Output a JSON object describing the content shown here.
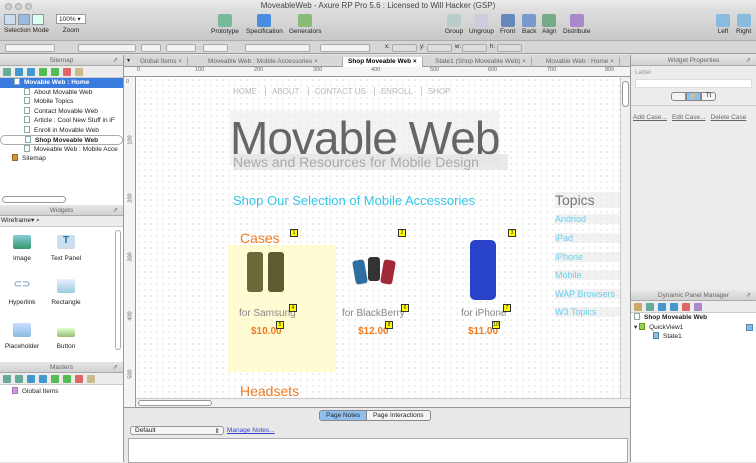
{
  "window": {
    "title": "MoveableWeb - Axure RP Pro 5.6 : Licensed to Will Hacker (GSP)"
  },
  "toolbar": {
    "selection_mode": "Selection Mode",
    "zoom_value": "100%",
    "zoom_label": "Zoom",
    "prototype": "Prototype",
    "specification": "Specification",
    "generators": "Generators",
    "group": "Group",
    "ungroup": "Ungroup",
    "front": "Front",
    "back": "Back",
    "align": "Align",
    "distribute": "Distribute",
    "left": "Left",
    "right": "Right"
  },
  "fmtbar": {
    "x": "x:",
    "y": "y:",
    "w": "w:",
    "h": "h:"
  },
  "sitemap": {
    "title": "Sitemap",
    "root": "Movable Web : Home",
    "items": [
      "About Movable Web",
      "Mobile Topics",
      "Contact Movable Web",
      "Article : Cool New Stuff in iF",
      "Enroll in Movable Web",
      "Shop Moveable Web",
      "Moveable Web : Mobile Acce"
    ],
    "sitemap_node": "Sitemap"
  },
  "widgets": {
    "title": "Widgets",
    "library": "Wireframe",
    "items": [
      "Image",
      "Text Panel",
      "Hyperlink",
      "Rectangle",
      "Placeholder",
      "Button"
    ]
  },
  "masters": {
    "title": "Masters",
    "items": [
      "Global Items"
    ]
  },
  "tabs": [
    "Global Items",
    "Moveable Web : Mobile Accessories",
    "Shop Moveable Web",
    "State1 (Shop Moveable Web)",
    "Movable Web : Home"
  ],
  "ruler": [
    "0",
    "100",
    "200",
    "300",
    "400",
    "500",
    "600",
    "700",
    "800"
  ],
  "vruler": [
    "0",
    "100",
    "200",
    "300",
    "400",
    "500"
  ],
  "page": {
    "nav": [
      "HOME",
      "ABOUT",
      "CONTACT US",
      "ENROLL",
      "SHOP"
    ],
    "logo": "Movable Web",
    "tagline": "News and Resources for Mobile Design",
    "headline": "Shop Our Selection of Mobile Accessories",
    "cases": "Cases",
    "headsets": "Headsets",
    "products": [
      {
        "name": "for Samsung",
        "price": "$10.00"
      },
      {
        "name": "for BlackBerry",
        "price": "$12.00"
      },
      {
        "name": "for iPhone",
        "price": "$11.00"
      }
    ],
    "footnotes": [
      "1",
      "2",
      "3",
      "4",
      "6",
      "7",
      "5",
      "8",
      "10"
    ],
    "topics_title": "Topics",
    "topics": [
      "Andriod",
      "iPad",
      "iPhone",
      "Mobile",
      "WAP Browsers",
      "W3 Topics"
    ]
  },
  "notes": {
    "tabs": [
      "Page Notes",
      "Page Interactions"
    ],
    "select": "Default",
    "manage": "Manage Notes..."
  },
  "widget_properties": {
    "title": "Widget Properties",
    "label": "Label",
    "label_value": "",
    "add": "Add Case...",
    "edit": "Edit Case...",
    "delete": "Delete Case"
  },
  "dynamic_panel": {
    "title": "Dynamic Panel Manager",
    "page": "Shop Moveable Web",
    "panel": "QuickView1",
    "state": "State1"
  },
  "colors": {
    "accent_cyan": "#33c6e8",
    "orange": "#f07a20",
    "selection": "#3a7be0"
  }
}
